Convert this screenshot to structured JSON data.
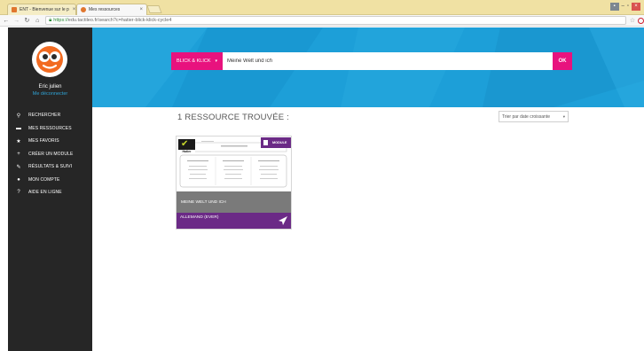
{
  "browser": {
    "tabs": [
      {
        "label": "ENT - Bienvenue sur le p",
        "favicon_color": "#e0762e",
        "active": false
      },
      {
        "label": "Mes ressources",
        "favicon_color": "#e0762e",
        "active": true
      }
    ],
    "close_glyph": "×",
    "url_scheme": "https://",
    "url_rest": "edu.tactileo.fr/search?c=hatier-blick-klick-cycle4",
    "lock_icon": "lock-icon",
    "window_buttons": [
      "▪",
      "‒",
      "▫",
      "×"
    ]
  },
  "sidebar": {
    "user_name": "Eric julien",
    "logout_label": "Me déconnecter",
    "items": [
      {
        "icon": "search-icon",
        "glyph": "⚲",
        "label": "RECHERCHER"
      },
      {
        "icon": "briefcase-icon",
        "glyph": "▬",
        "label": "MES RESSOURCES"
      },
      {
        "icon": "star-icon",
        "glyph": "★",
        "label": "MES FAVORIS"
      },
      {
        "icon": "plus-icon",
        "glyph": "+",
        "label": "CRÉER UN MODULE"
      },
      {
        "icon": "chart-icon",
        "glyph": "✎",
        "label": "RÉSULTATS & SUIVI"
      },
      {
        "icon": "user-icon",
        "glyph": "●",
        "label": "MON COMPTE"
      },
      {
        "icon": "help-icon",
        "glyph": "?",
        "label": "AIDE EN LIGNE"
      }
    ]
  },
  "search": {
    "category_label": "BLICK & KLICK",
    "category_caret": "▾",
    "query_value": "Meine Welt und ich",
    "ok_label": "OK"
  },
  "results": {
    "count_label": "1 RESSOURCE TROUVÉE :",
    "sort_label": "Trier par date croissante",
    "sort_caret": "▾"
  },
  "card": {
    "badge_label": "MODULE",
    "publisher": "Hatier",
    "check_glyph": "✔",
    "title": "MEINE WELT UND ICH",
    "subject": "ALLEMAND (EVER)"
  },
  "colors": {
    "accent_pink": "#e8127e",
    "header_blue": "#1d9fd8",
    "sidebar_bg": "#262626",
    "module_purple": "#6b2a86",
    "logo_orange": "#f26b21"
  }
}
